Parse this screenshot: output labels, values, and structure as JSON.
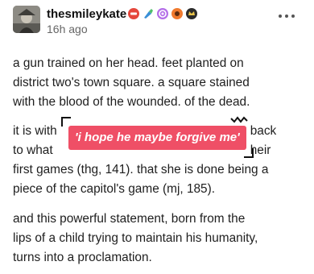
{
  "post": {
    "username": "thesmileykate",
    "timestamp": "16h ago",
    "badges": [
      "badge-icon",
      "paintbrush-icon",
      "swirl-icon",
      "flower-icon",
      "crown-icon"
    ],
    "paragraphs": [
      [
        "a gun trained on her head. feet planted on",
        "district two's town square. a square stained",
        "with the blood of the wounded. of the dead."
      ],
      [
        "it is with",
        "s back",
        "to what",
        "e their",
        "first games (thg, 141). that she is done being a",
        "piece of the capitol's game (mj, 185)."
      ],
      [
        "and this powerful statement, born from the",
        "lips of a child trying to maintain his humanity,",
        "turns into a proclamation."
      ]
    ]
  },
  "overlay": {
    "caption": "'i hope he maybe forgive me'"
  },
  "colors": {
    "caption_bg": "#ef4f66",
    "caption_text": "#ffffff"
  }
}
